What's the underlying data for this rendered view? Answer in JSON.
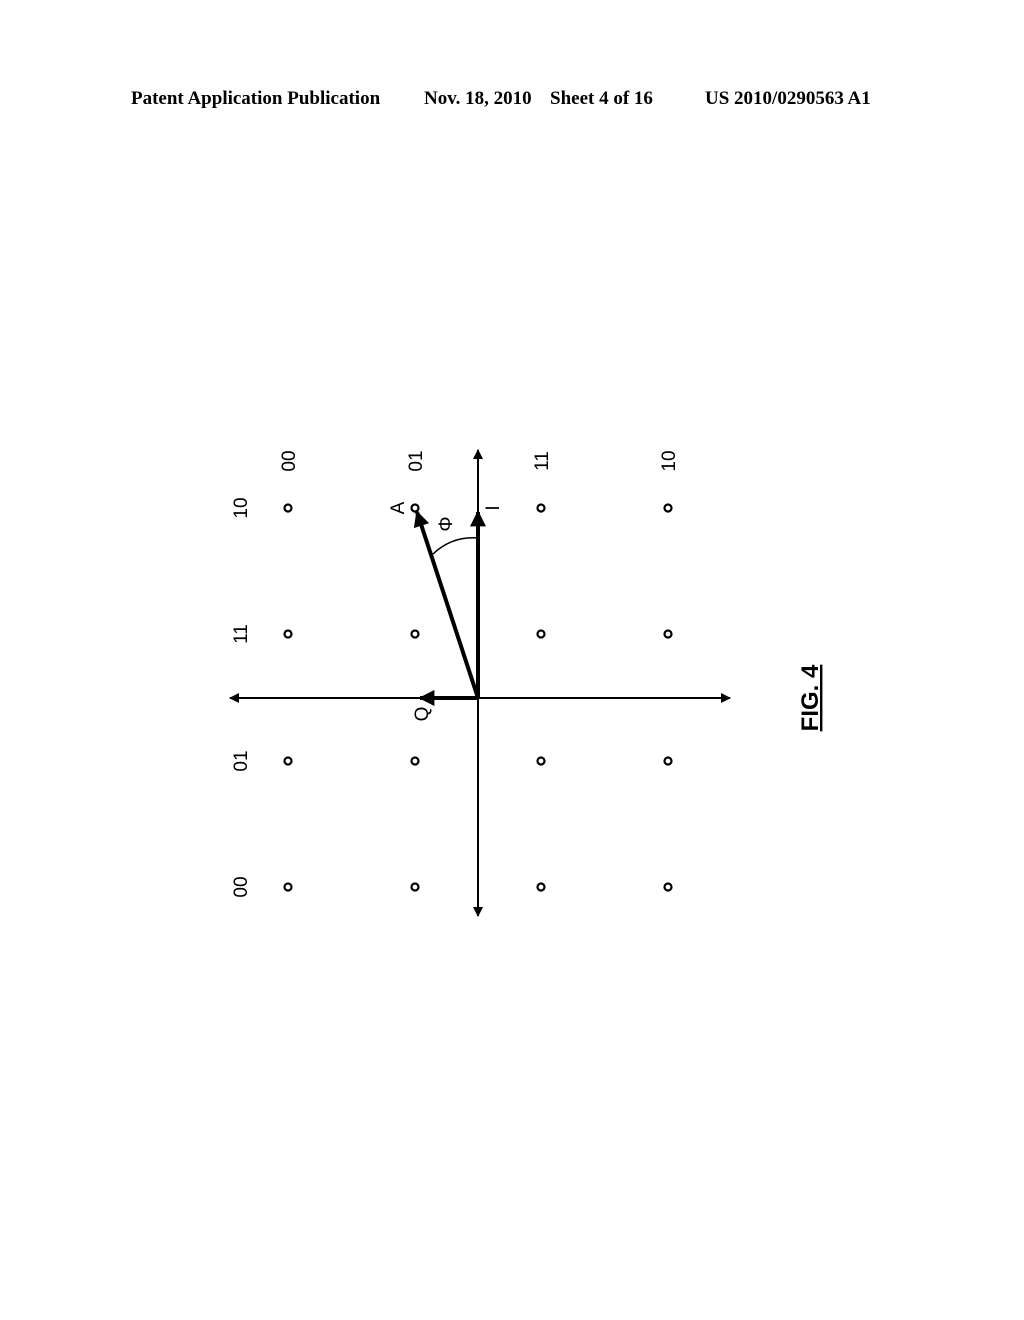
{
  "header": {
    "publication": "Patent Application Publication",
    "date": "Nov. 18, 2010",
    "sheet": "Sheet 4 of 16",
    "number": "US 2010/0290563 A1"
  },
  "figure": {
    "label": "FIG. 4",
    "type": "16-QAM constellation diagram (rotated 90°)",
    "i_axis_label": "I",
    "q_axis_label": "Q",
    "vector_label": "A",
    "angle_label": "Φ",
    "row_labels": [
      "10",
      "11",
      "01",
      "00"
    ],
    "column_labels": [
      "00",
      "01",
      "11",
      "10"
    ],
    "vector_target": {
      "row": 0,
      "col": 1
    }
  }
}
